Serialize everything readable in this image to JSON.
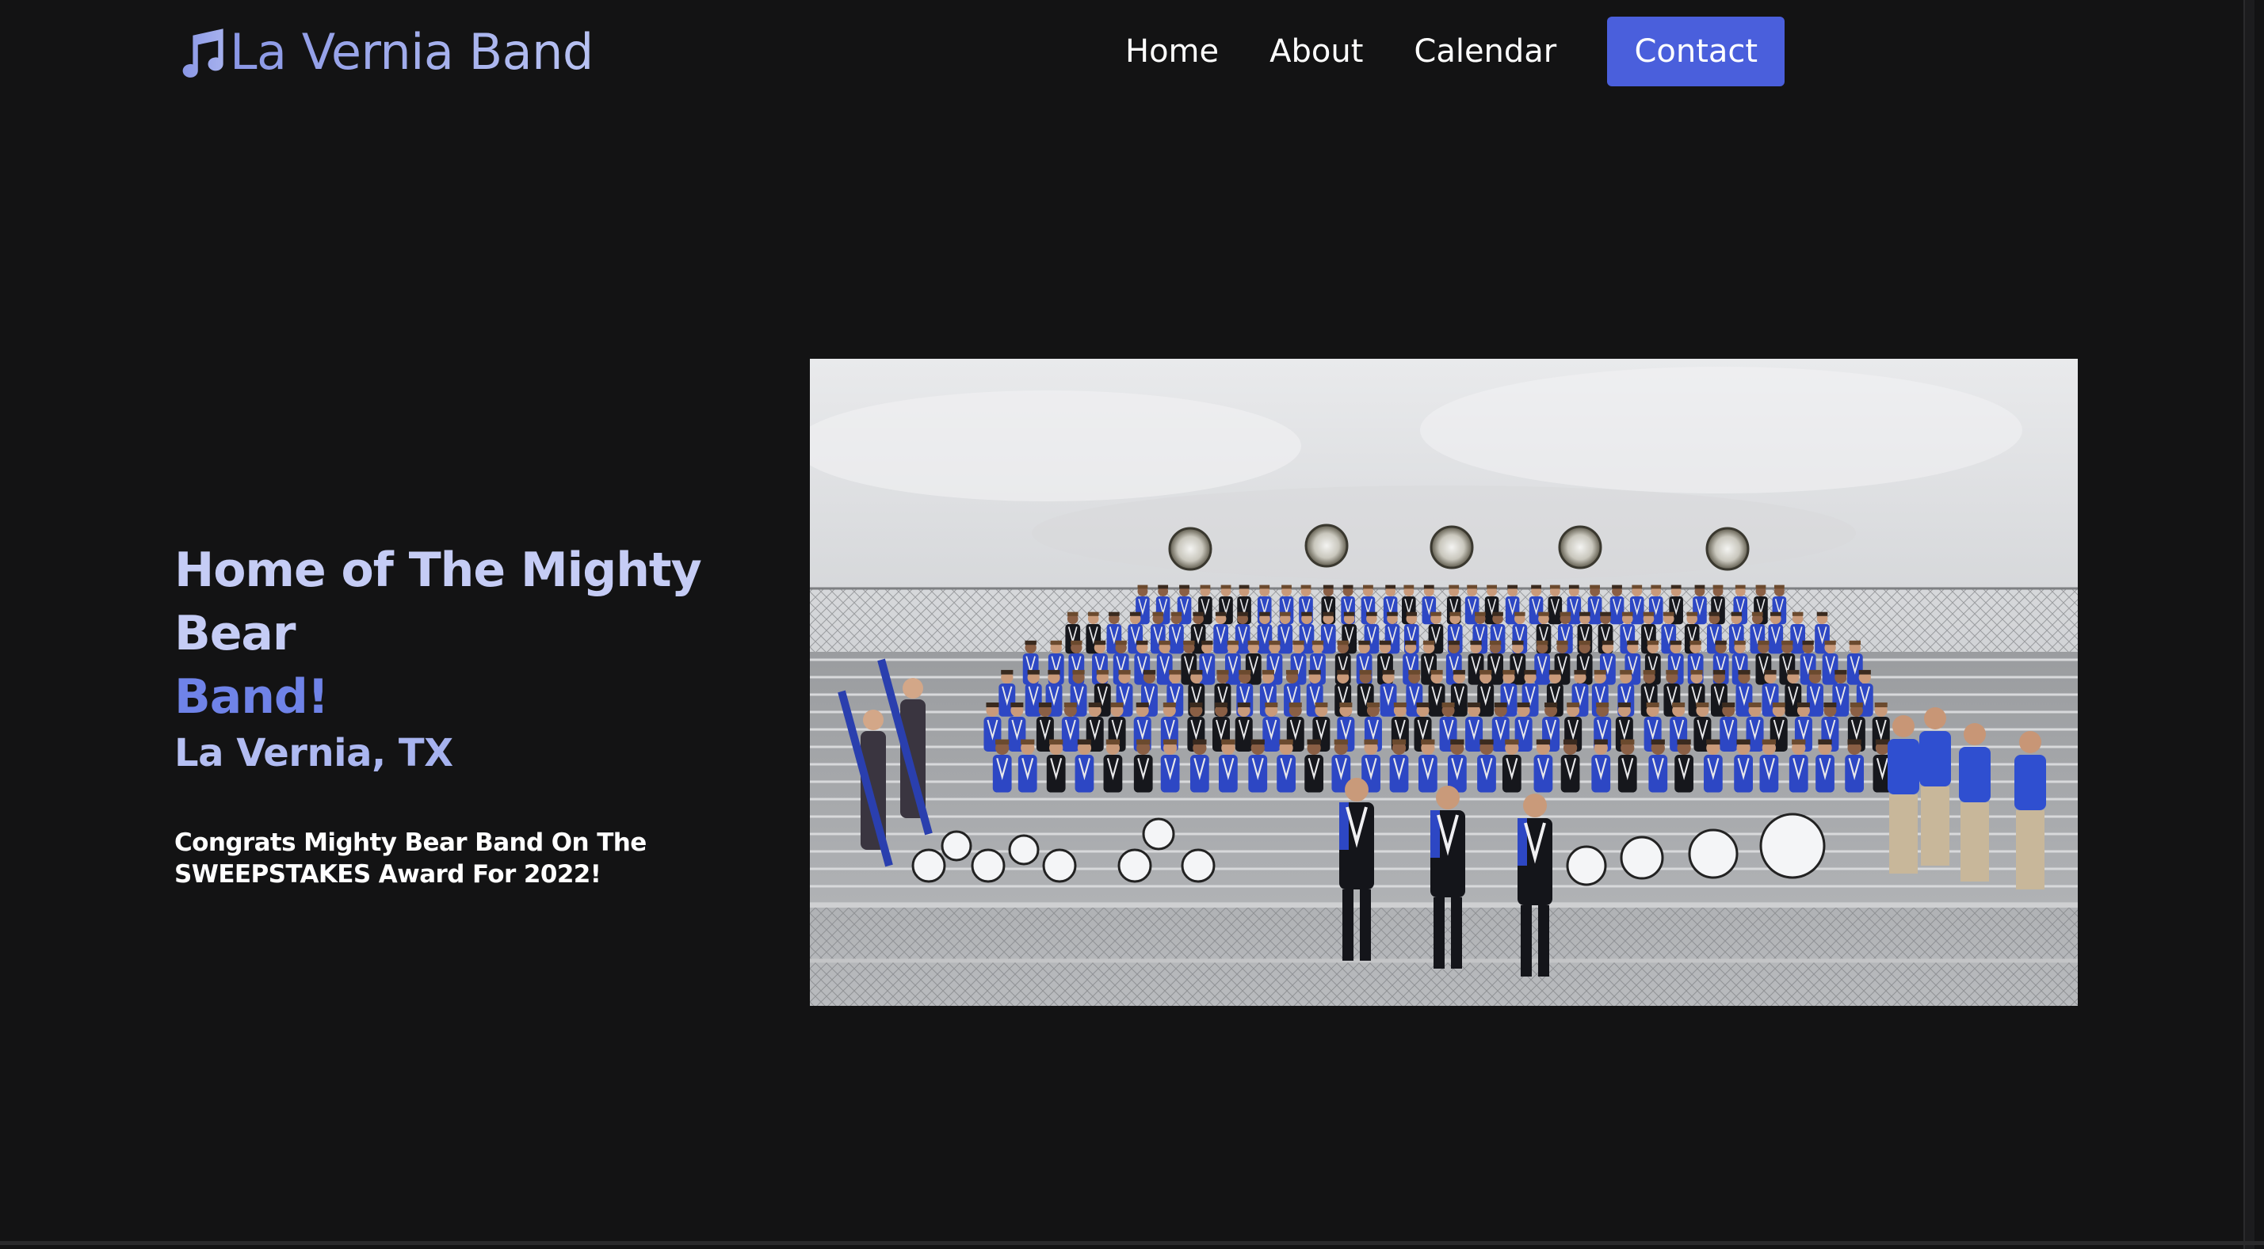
{
  "brand": {
    "name": "La Vernia Band",
    "icon": "music-note-icon",
    "gradient": [
      "#8a97e6",
      "#b8c2f2"
    ]
  },
  "nav": {
    "items": [
      {
        "label": "Home"
      },
      {
        "label": "About"
      },
      {
        "label": "Calendar"
      }
    ],
    "contact_label": "Contact",
    "contact_color": "#4a5fdc"
  },
  "hero": {
    "title_part1": "Home of The Mighty Bear",
    "title_part2": "Band!",
    "location": "La Vernia, TX",
    "description": "Congrats Mighty Bear Band On The SWEEPSTAKES Award For 2022!",
    "image_subject": "band-group-photo"
  },
  "colors": {
    "background": "#131314",
    "accent": "#4a5fdc",
    "title_light": "#c5ccf5",
    "title_blue": "#6f83e8"
  }
}
